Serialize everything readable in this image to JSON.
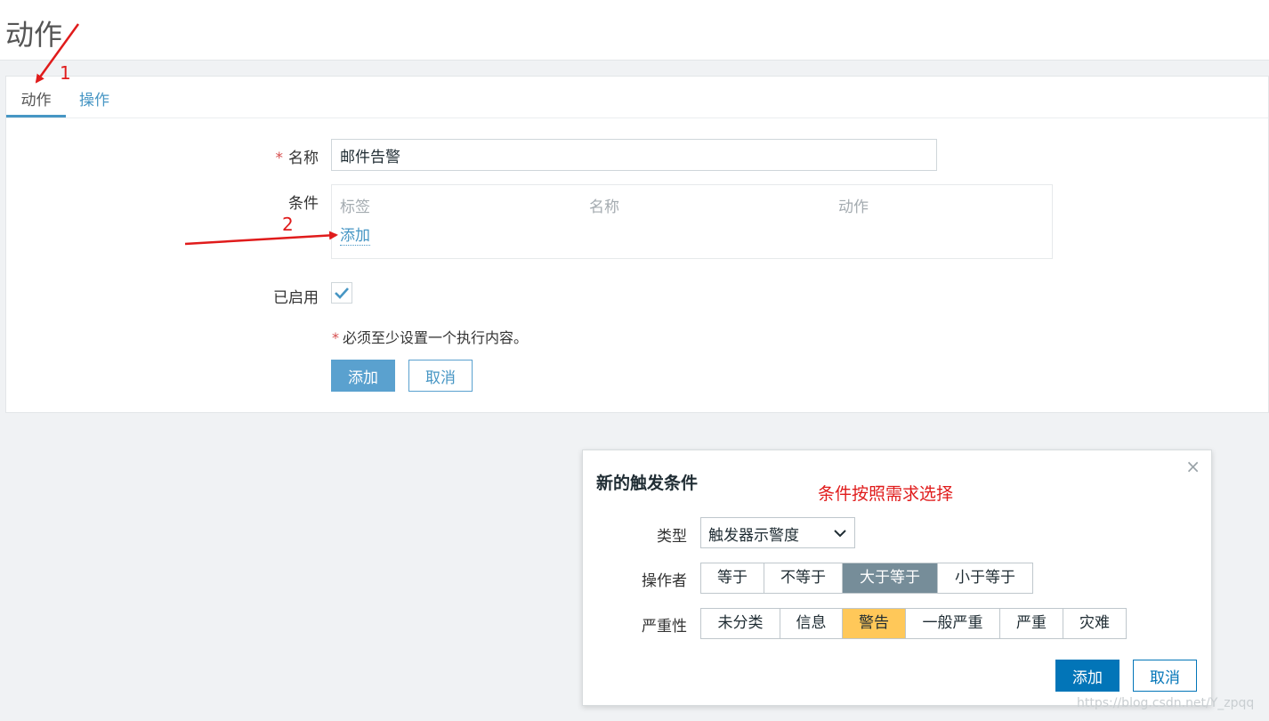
{
  "header": {
    "title": "动作"
  },
  "tabs": [
    {
      "label": "动作"
    },
    {
      "label": "操作"
    }
  ],
  "form": {
    "name_label": "名称",
    "name_value": "邮件告警",
    "required_mark": "*",
    "conditions_label": "条件",
    "conditions_columns": [
      "标签",
      "名称",
      "动作"
    ],
    "conditions_add": "添加",
    "enabled_label": "已启用",
    "enabled_checked": true,
    "note": "必须至少设置一个执行内容。",
    "add_button": "添加",
    "cancel_button": "取消"
  },
  "dialog": {
    "title": "新的触发条件",
    "close_glyph": "×",
    "type_label": "类型",
    "type_value": "触发器示警度",
    "operator_label": "操作者",
    "operator_options": [
      "等于",
      "不等于",
      "大于等于",
      "小于等于"
    ],
    "operator_selected": "大于等于",
    "severity_label": "严重性",
    "severity_options": [
      "未分类",
      "信息",
      "警告",
      "一般严重",
      "严重",
      "灾难"
    ],
    "severity_selected": "警告",
    "add_button": "添加",
    "cancel_button": "取消"
  },
  "annotations": {
    "step1": "1",
    "step2": "2",
    "hint": "条件按照需求选择"
  },
  "watermark": "https://blog.csdn.net/Y_zpqq",
  "colors": {
    "link_blue": "#4796c4",
    "primary_button": "#5aa1cf",
    "dialog_primary": "#0275b8",
    "selected_operator": "#768d99",
    "selected_severity": "#ffc859",
    "annotation_red": "#e01b1b",
    "required_red": "#d64e4e"
  },
  "icons": {
    "checkbox": "checkmark-icon",
    "select": "chevron-down-icon",
    "close": "close-icon"
  }
}
